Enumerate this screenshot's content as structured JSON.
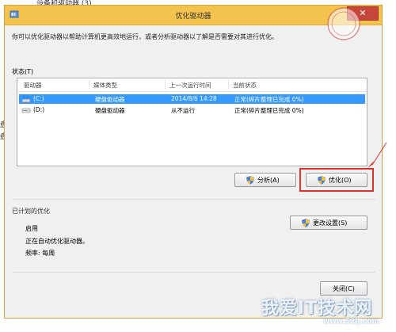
{
  "background": {
    "breadcrumb": "设备和驱动器 (3)",
    "side_chars": [
      "盘",
      "盘"
    ]
  },
  "window": {
    "title": "优化驱动器",
    "close_glyph": "✕"
  },
  "intro_text": "你可以优化驱动器以帮助计算机更高效地运行，或者分析驱动器以了解是否需要对其进行优化。",
  "status": {
    "label": "状态(T)",
    "columns": [
      "驱动器",
      "媒体类型",
      "上一次运行时间",
      "当前状态"
    ],
    "rows": [
      {
        "drive": "(C:)",
        "media": "硬盘驱动器",
        "last_run": "2014/8/6 14:28",
        "status": "正常(碎片整理已完成 0%)",
        "selected": true
      },
      {
        "drive": "(D:)",
        "media": "硬盘驱动器",
        "last_run": "从不运行",
        "status": "正常(碎片整理已完成 0%)",
        "selected": false
      }
    ]
  },
  "buttons": {
    "analyze": "分析(A)",
    "optimize": "优化(O)",
    "change_settings": "更改设置(S)",
    "close": "关闭(C)"
  },
  "scheduled": {
    "title": "已计划的优化",
    "enabled": "启用",
    "running": "正在自动优化驱动器。",
    "frequency": "频率: 每周"
  },
  "colors": {
    "titlebar": "#f3c34e",
    "selection": "#3399ff",
    "highlight": "#d8352c",
    "close_button": "#c7463a"
  }
}
